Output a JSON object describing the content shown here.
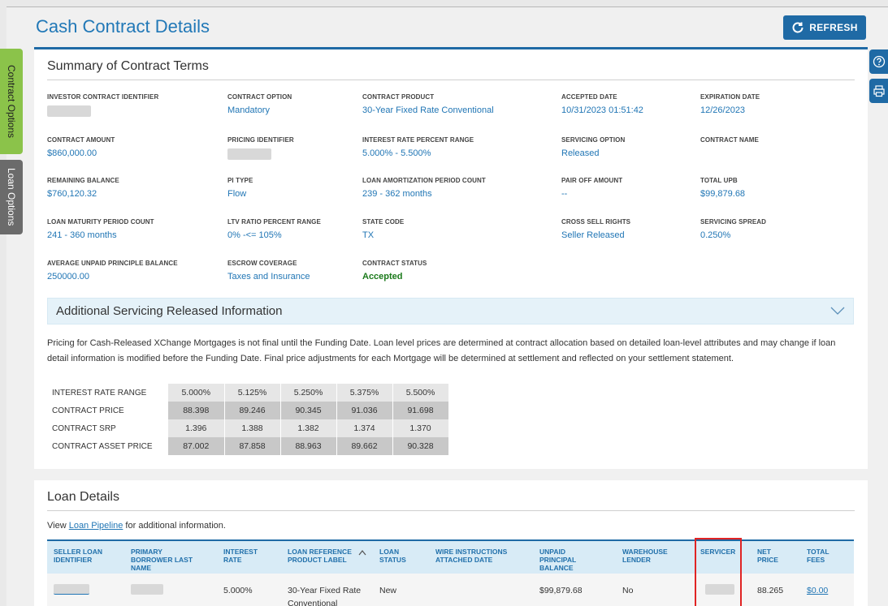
{
  "page": {
    "title": "Cash Contract Details"
  },
  "toolbar": {
    "refresh_label": "REFRESH"
  },
  "side_tabs": {
    "contract_options": "Contract Options",
    "loan_options": "Loan Options"
  },
  "summary": {
    "title": "Summary of Contract Terms",
    "fields": [
      {
        "label": "INVESTOR CONTRACT IDENTIFIER",
        "value": ""
      },
      {
        "label": "CONTRACT OPTION",
        "value": "Mandatory"
      },
      {
        "label": "CONTRACT PRODUCT",
        "value": "30-Year Fixed Rate Conventional"
      },
      {
        "label": "ACCEPTED DATE",
        "value": "10/31/2023 01:51:42"
      },
      {
        "label": "EXPIRATION DATE",
        "value": "12/26/2023"
      },
      {
        "label": "CONTRACT AMOUNT",
        "value": "$860,000.00"
      },
      {
        "label": "PRICING IDENTIFIER",
        "value": ""
      },
      {
        "label": "INTEREST RATE PERCENT RANGE",
        "value": "5.000% - 5.500%"
      },
      {
        "label": "SERVICING OPTION",
        "value": "Released"
      },
      {
        "label": "CONTRACT NAME",
        "value": ""
      },
      {
        "label": "REMAINING BALANCE",
        "value": "$760,120.32"
      },
      {
        "label": "PI TYPE",
        "value": "Flow"
      },
      {
        "label": "LOAN AMORTIZATION PERIOD COUNT",
        "value": "239 - 362 months"
      },
      {
        "label": "PAIR OFF AMOUNT",
        "value": "--"
      },
      {
        "label": "TOTAL UPB",
        "value": "$99,879.68"
      },
      {
        "label": "LOAN MATURITY PERIOD COUNT",
        "value": "241 - 360 months"
      },
      {
        "label": "LTV RATIO PERCENT RANGE",
        "value": "0% -<= 105%"
      },
      {
        "label": "STATE CODE",
        "value": "TX"
      },
      {
        "label": "CROSS SELL RIGHTS",
        "value": "Seller Released"
      },
      {
        "label": "SERVICING SPREAD",
        "value": "0.250%"
      },
      {
        "label": "AVERAGE UNPAID PRINCIPLE BALANCE",
        "value": "250000.00"
      },
      {
        "label": "ESCROW COVERAGE",
        "value": "Taxes and Insurance"
      },
      {
        "label": "CONTRACT STATUS",
        "value": "Accepted"
      }
    ]
  },
  "additional": {
    "title": "Additional Servicing Released Information",
    "note": "Pricing for Cash-Released XChange Mortgages is not final until the Funding Date. Loan level prices are determined at contract allocation based on detailed loan-level attributes and may change if loan detail information is modified before the Funding Date. Final price adjustments for each Mortgage will be determined at settlement and reflected on your settlement statement.",
    "pricing_table": {
      "rows": [
        {
          "label": "INTEREST RATE RANGE",
          "values": [
            "5.000%",
            "5.125%",
            "5.250%",
            "5.375%",
            "5.500%"
          ]
        },
        {
          "label": "CONTRACT PRICE",
          "values": [
            "88.398",
            "89.246",
            "90.345",
            "91.036",
            "91.698"
          ]
        },
        {
          "label": "CONTRACT SRP",
          "values": [
            "1.396",
            "1.388",
            "1.382",
            "1.374",
            "1.370"
          ]
        },
        {
          "label": "CONTRACT ASSET PRICE",
          "values": [
            "87.002",
            "87.858",
            "88.963",
            "89.662",
            "90.328"
          ]
        }
      ]
    }
  },
  "loans": {
    "title": "Loan Details",
    "pipeline_prefix": "View ",
    "pipeline_link": "Loan Pipeline",
    "pipeline_suffix": " for additional information.",
    "columns": [
      "SELLER LOAN IDENTIFIER",
      "PRIMARY BORROWER LAST NAME",
      "INTEREST RATE",
      "LOAN REFERENCE PRODUCT LABEL",
      "LOAN STATUS",
      "WIRE INSTRUCTIONS ATTACHED DATE",
      "UNPAID PRINCIPAL BALANCE",
      "WAREHOUSE LENDER",
      "SERVICER",
      "NET PRICE",
      "TOTAL FEES"
    ],
    "row": {
      "seller_loan_id": "",
      "borrower_last_name": "",
      "interest_rate": "5.000%",
      "product_label": "30-Year Fixed Rate Conventional",
      "status": "New",
      "wire_date": "",
      "unpaid_balance": "$99,879.68",
      "warehouse_lender": "No",
      "servicer": "",
      "net_price": "88.265",
      "total_fees": "$0.00"
    }
  },
  "colors": {
    "accent": "#1f6aa5",
    "link": "#2176b5",
    "status_accepted": "#1b7a1b",
    "contract_tab": "#8bc34a",
    "highlight": "#e02424"
  },
  "icons": [
    "refresh-icon",
    "help-icon",
    "print-icon",
    "chevron-down-icon",
    "sort-up-icon"
  ]
}
